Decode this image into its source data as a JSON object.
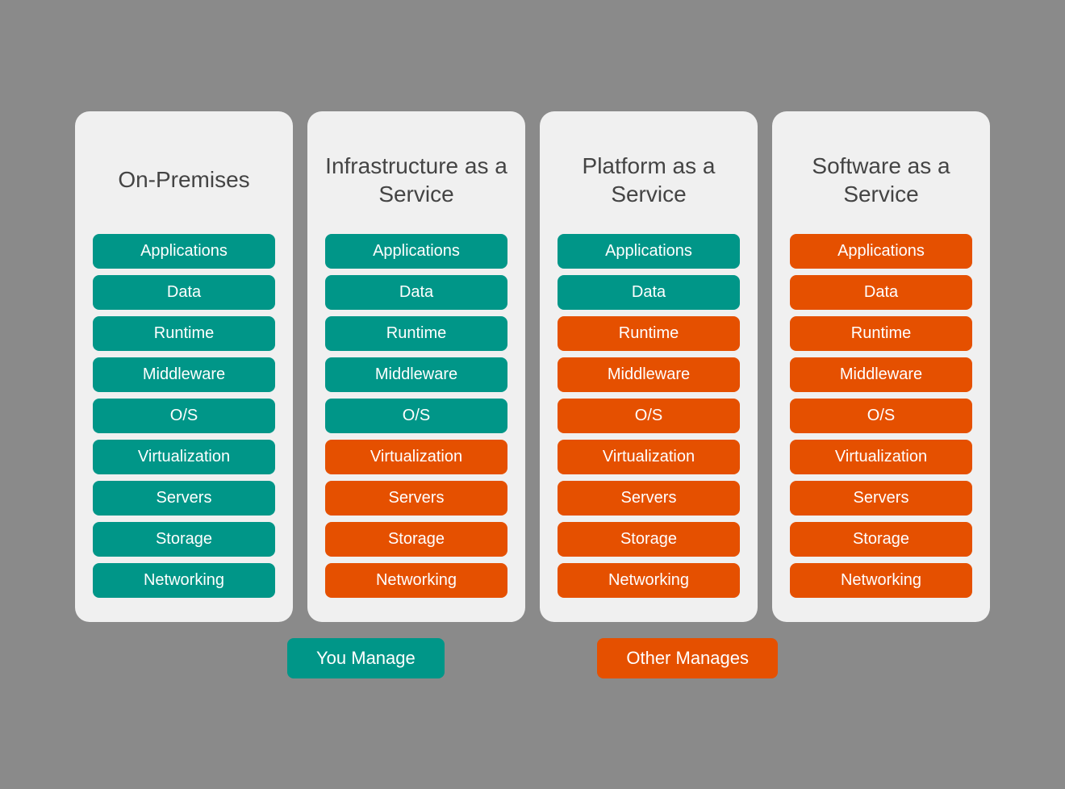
{
  "columns": [
    {
      "id": "on-premises",
      "title": "On-Premises",
      "items": [
        {
          "label": "Applications",
          "color": "teal"
        },
        {
          "label": "Data",
          "color": "teal"
        },
        {
          "label": "Runtime",
          "color": "teal"
        },
        {
          "label": "Middleware",
          "color": "teal"
        },
        {
          "label": "O/S",
          "color": "teal"
        },
        {
          "label": "Virtualization",
          "color": "teal"
        },
        {
          "label": "Servers",
          "color": "teal"
        },
        {
          "label": "Storage",
          "color": "teal"
        },
        {
          "label": "Networking",
          "color": "teal"
        }
      ]
    },
    {
      "id": "iaas",
      "title": "Infrastructure as a Service",
      "items": [
        {
          "label": "Applications",
          "color": "teal"
        },
        {
          "label": "Data",
          "color": "teal"
        },
        {
          "label": "Runtime",
          "color": "teal"
        },
        {
          "label": "Middleware",
          "color": "teal"
        },
        {
          "label": "O/S",
          "color": "teal"
        },
        {
          "label": "Virtualization",
          "color": "orange"
        },
        {
          "label": "Servers",
          "color": "orange"
        },
        {
          "label": "Storage",
          "color": "orange"
        },
        {
          "label": "Networking",
          "color": "orange"
        }
      ]
    },
    {
      "id": "paas",
      "title": "Platform as a Service",
      "items": [
        {
          "label": "Applications",
          "color": "teal"
        },
        {
          "label": "Data",
          "color": "teal"
        },
        {
          "label": "Runtime",
          "color": "orange"
        },
        {
          "label": "Middleware",
          "color": "orange"
        },
        {
          "label": "O/S",
          "color": "orange"
        },
        {
          "label": "Virtualization",
          "color": "orange"
        },
        {
          "label": "Servers",
          "color": "orange"
        },
        {
          "label": "Storage",
          "color": "orange"
        },
        {
          "label": "Networking",
          "color": "orange"
        }
      ]
    },
    {
      "id": "saas",
      "title": "Software as a Service",
      "items": [
        {
          "label": "Applications",
          "color": "orange"
        },
        {
          "label": "Data",
          "color": "orange"
        },
        {
          "label": "Runtime",
          "color": "orange"
        },
        {
          "label": "Middleware",
          "color": "orange"
        },
        {
          "label": "O/S",
          "color": "orange"
        },
        {
          "label": "Virtualization",
          "color": "orange"
        },
        {
          "label": "Servers",
          "color": "orange"
        },
        {
          "label": "Storage",
          "color": "orange"
        },
        {
          "label": "Networking",
          "color": "orange"
        }
      ]
    }
  ],
  "legend": {
    "you_manage": "You Manage",
    "other_manages": "Other Manages"
  }
}
